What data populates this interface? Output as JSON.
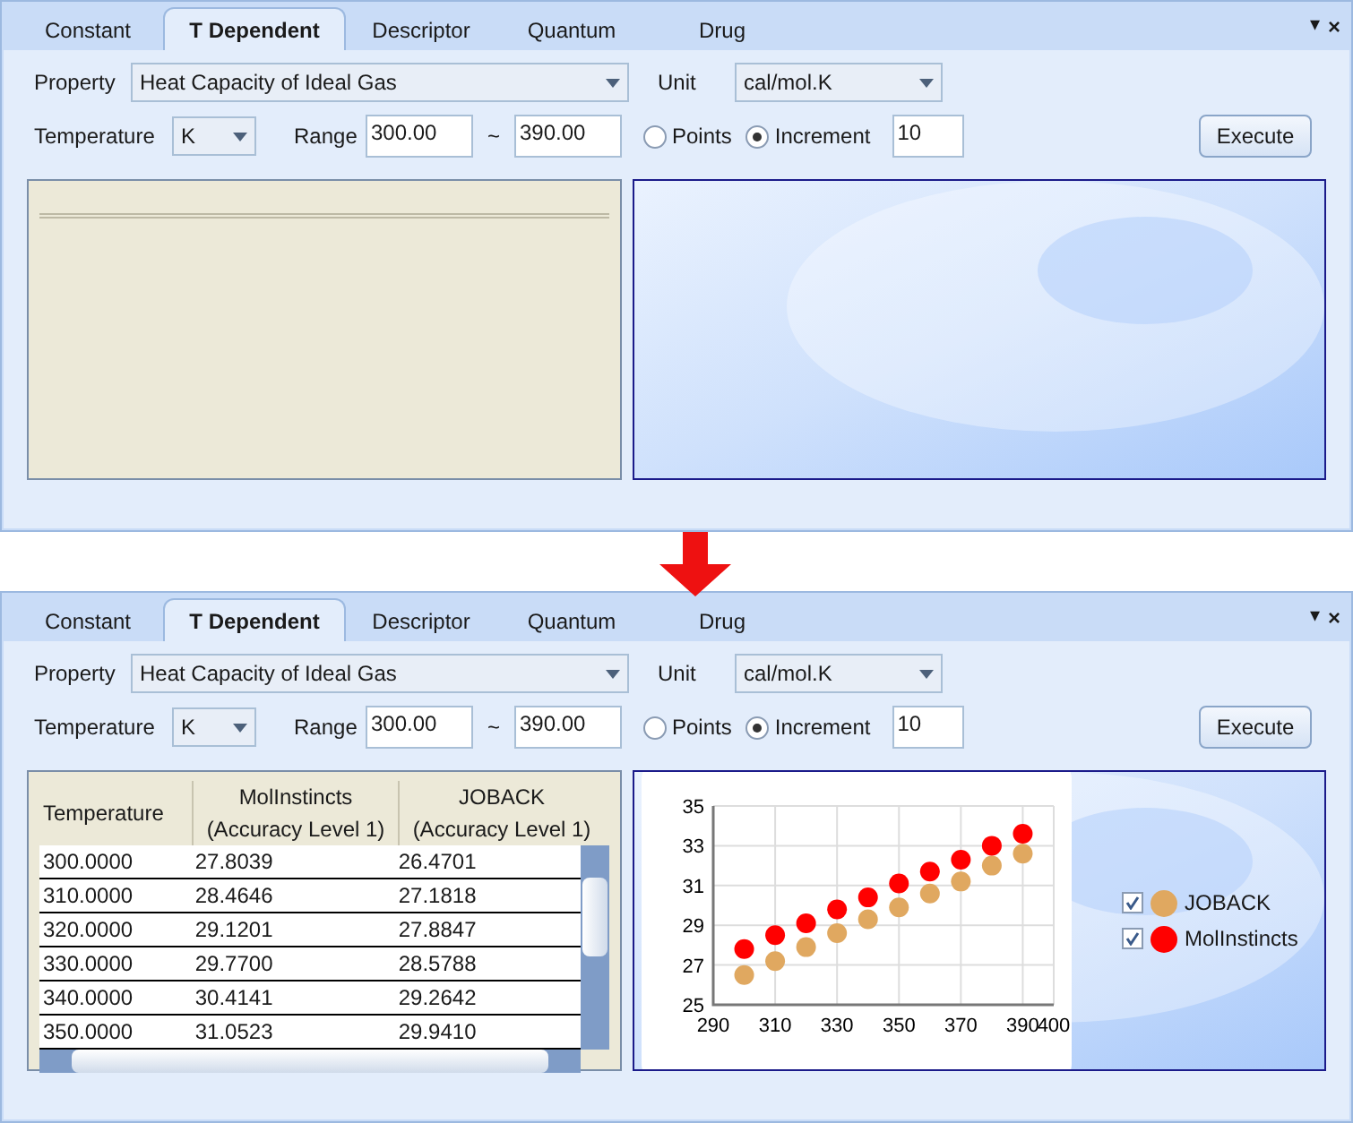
{
  "panels": [
    {
      "tabs": [
        {
          "label": "Constant",
          "selected": false
        },
        {
          "label": "T Dependent",
          "selected": true
        },
        {
          "label": "Descriptor",
          "selected": false
        },
        {
          "label": "Quantum",
          "selected": false
        },
        {
          "label": "Drug",
          "selected": false
        }
      ],
      "menu_glyph": "▾",
      "close_glyph": "×",
      "property": {
        "label": "Property",
        "value": "Heat Capacity of Ideal Gas"
      },
      "unit": {
        "label": "Unit",
        "value": "cal/mol.K"
      },
      "temperature": {
        "label": "Temperature",
        "value": "K"
      },
      "range": {
        "label": "Range",
        "from": "300.00",
        "separator": "~",
        "to": "390.00"
      },
      "modes": [
        {
          "label": "Points",
          "selected": false
        },
        {
          "label": "Increment",
          "selected": true
        }
      ],
      "increment": "10",
      "execute": "Execute"
    },
    {
      "tabs": [
        {
          "label": "Constant",
          "selected": false
        },
        {
          "label": "T Dependent",
          "selected": true
        },
        {
          "label": "Descriptor",
          "selected": false
        },
        {
          "label": "Quantum",
          "selected": false
        },
        {
          "label": "Drug",
          "selected": false
        }
      ],
      "menu_glyph": "▾",
      "close_glyph": "×",
      "property": {
        "label": "Property",
        "value": "Heat Capacity of Ideal Gas"
      },
      "unit": {
        "label": "Unit",
        "value": "cal/mol.K"
      },
      "temperature": {
        "label": "Temperature",
        "value": "K"
      },
      "range": {
        "label": "Range",
        "from": "300.00",
        "separator": "~",
        "to": "390.00"
      },
      "modes": [
        {
          "label": "Points",
          "selected": false
        },
        {
          "label": "Increment",
          "selected": true
        }
      ],
      "increment": "10",
      "execute": "Execute",
      "table": {
        "columns": [
          "Temperature",
          "MolInstincts\n(Accuracy Level 1)",
          "JOBACK\n(Accuracy Level 1)"
        ],
        "rows": [
          [
            "300.0000",
            "27.8039",
            "26.4701"
          ],
          [
            "310.0000",
            "28.4646",
            "27.1818"
          ],
          [
            "320.0000",
            "29.1201",
            "27.8847"
          ],
          [
            "330.0000",
            "29.7700",
            "28.5788"
          ],
          [
            "340.0000",
            "30.4141",
            "29.2642"
          ],
          [
            "350.0000",
            "31.0523",
            "29.9410"
          ]
        ]
      },
      "chart": {
        "chart_data": {
          "type": "scatter",
          "grid": true,
          "x": [
            300,
            310,
            320,
            330,
            340,
            350,
            360,
            370,
            380,
            390
          ],
          "xlim": [
            290,
            400
          ],
          "ylim": [
            25,
            35
          ],
          "xticks": [
            290,
            310,
            330,
            350,
            370,
            390,
            400
          ],
          "yticks": [
            25,
            27,
            29,
            31,
            33,
            35
          ],
          "series": [
            {
              "name": "JOBACK",
              "color": "#e0a860",
              "values": [
                26.5,
                27.2,
                27.9,
                28.6,
                29.3,
                29.9,
                30.6,
                31.2,
                32.0,
                32.6
              ]
            },
            {
              "name": "MolInstincts",
              "color": "#ff0000",
              "values": [
                27.8,
                28.5,
                29.1,
                29.8,
                30.4,
                31.1,
                31.7,
                32.3,
                33.0,
                33.6
              ]
            }
          ]
        },
        "legend": [
          {
            "checked": true
          },
          {
            "checked": true
          }
        ]
      }
    }
  ]
}
